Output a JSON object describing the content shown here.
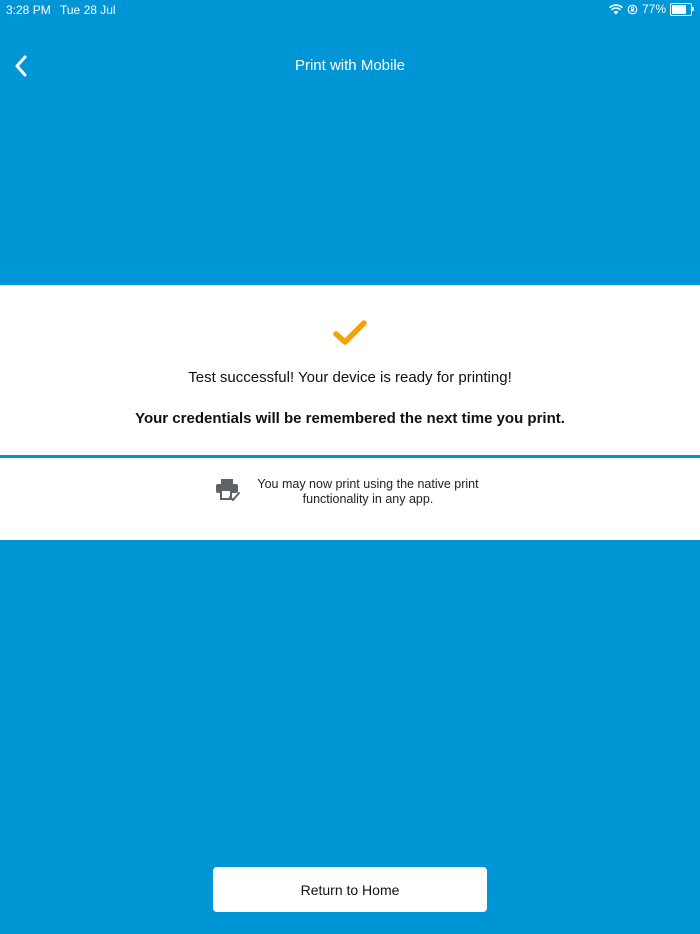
{
  "status_bar": {
    "time": "3:28 PM",
    "date": "Tue 28 Jul",
    "battery": "77%",
    "battery_level": 0.77
  },
  "nav": {
    "title": "Print with Mobile",
    "back_icon": "chevron-left-icon"
  },
  "result": {
    "icon": "checkmark-icon",
    "message": "Test successful! Your device is ready for printing!",
    "credentials_note": "Your credentials will be remembered the next time you print."
  },
  "info": {
    "icon": "printer-check-icon",
    "text": "You may now print using the native print functionality in any app."
  },
  "actions": {
    "return_home_label": "Return to Home"
  },
  "colors": {
    "background": "#0095d5",
    "panel": "#ffffff",
    "check": "#f5a300"
  }
}
